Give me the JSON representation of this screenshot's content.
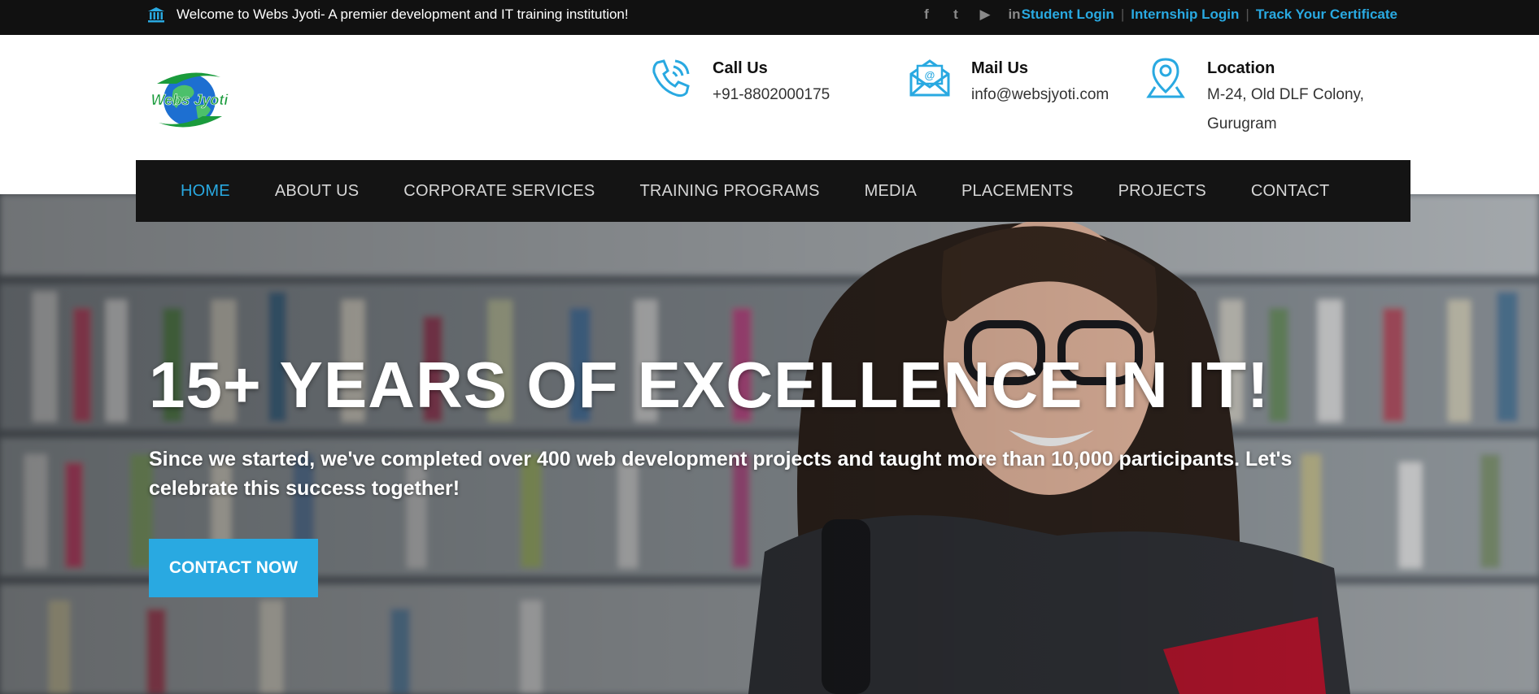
{
  "topbar": {
    "welcome": "Welcome to Webs Jyoti- A premier development and IT training institution!",
    "social": [
      {
        "icon": "facebook-icon",
        "glyph": "f"
      },
      {
        "icon": "twitter-icon",
        "glyph": "t"
      },
      {
        "icon": "youtube-icon",
        "glyph": "▶"
      },
      {
        "icon": "linkedin-icon",
        "glyph": "in"
      }
    ],
    "links": [
      "Student Login",
      "Internship Login",
      "Track Your Certificate"
    ]
  },
  "header": {
    "logo_text": "Webs Jyoti",
    "call": {
      "title": "Call Us",
      "value": "+91-8802000175"
    },
    "mail": {
      "title": "Mail Us",
      "value": "info@websjyoti.com"
    },
    "location": {
      "title": "Location",
      "value": "M-24, Old DLF Colony, Gurugram"
    }
  },
  "nav": {
    "items": [
      "HOME",
      "ABOUT US",
      "CORPORATE SERVICES",
      "TRAINING PROGRAMS",
      "MEDIA",
      "PLACEMENTS",
      "PROJECTS",
      "CONTACT"
    ],
    "active": "HOME"
  },
  "hero": {
    "heading": "15+ YEARS OF EXCELLENCE IN IT!",
    "text": "Since we started, we've completed over 400 web development projects and taught more than 10,000 participants. Let's celebrate this success together!",
    "button": "CONTACT NOW"
  },
  "colors": {
    "accent": "#29a9e1",
    "topbar_bg": "#111111",
    "nav_bg": "#141414"
  }
}
